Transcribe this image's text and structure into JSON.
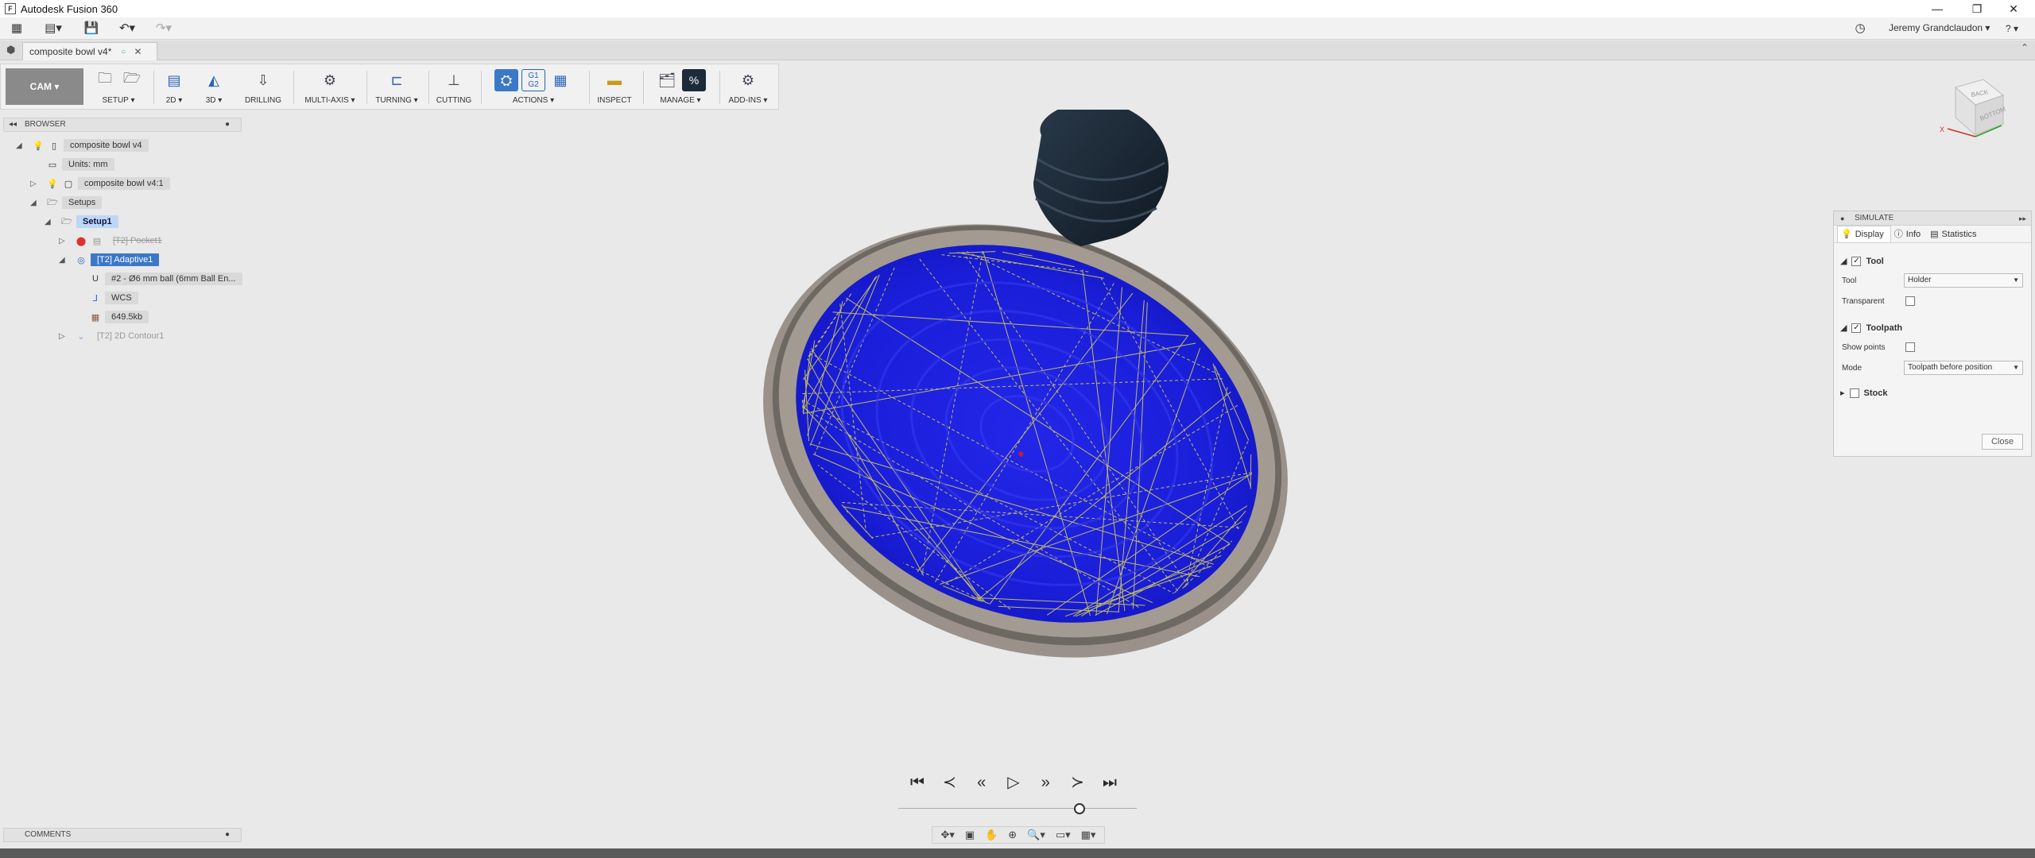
{
  "window": {
    "title": "Autodesk Fusion 360",
    "controls": [
      "—",
      "❐",
      "✕"
    ]
  },
  "qat": {
    "user_name": "Jeremy Grandclaudon ▾",
    "help": "? ▾"
  },
  "document_tab": {
    "name": "composite bowl v4*",
    "close": "✕"
  },
  "toolbar": {
    "workspace": "CAM ▾",
    "groups": [
      {
        "label": "SETUP ▾"
      },
      {
        "label": "2D ▾"
      },
      {
        "label": "3D ▾"
      },
      {
        "label": "DRILLING"
      },
      {
        "label": "MULTI-AXIS ▾"
      },
      {
        "label": "TURNING ▾"
      },
      {
        "label": "CUTTING"
      },
      {
        "label": "ACTIONS ▾"
      },
      {
        "label": "INSPECT"
      },
      {
        "label": "MANAGE ▾"
      },
      {
        "label": "ADD-INS ▾"
      }
    ],
    "g1g2": "G1\nG2",
    "percent": "%"
  },
  "browser": {
    "title": "BROWSER",
    "nodes": [
      {
        "label": "composite bowl v4"
      },
      {
        "label": "Units: mm"
      },
      {
        "label": "composite bowl v4:1"
      },
      {
        "label": "Setups"
      },
      {
        "label": "Setup1"
      },
      {
        "label": "[T2] Pocket1"
      },
      {
        "label": "[T2] Adaptive1"
      },
      {
        "label": "#2 - Ø6 mm ball (6mm Ball En..."
      },
      {
        "label": "WCS"
      },
      {
        "label": "649.5kb"
      },
      {
        "label": "[T2] 2D Contour1"
      }
    ]
  },
  "viewcube": {
    "top_face": "BACK",
    "side_face": "BOTTOM",
    "axis_x": "X"
  },
  "simulate": {
    "title": "SIMULATE",
    "tabs": [
      "Display",
      "Info",
      "Statistics"
    ],
    "tool_section": "Tool",
    "tool_label": "Tool",
    "tool_value": "Holder",
    "transparent_label": "Transparent",
    "toolpath_section": "Toolpath",
    "show_points_label": "Show points",
    "mode_label": "Mode",
    "mode_value": "Toolpath before position",
    "stock_section": "Stock",
    "close_label": "Close"
  },
  "comments": {
    "title": "COMMENTS"
  },
  "playback": {
    "position_fraction": 0.76
  },
  "colors": {
    "stock_blue": "#1a1ee0",
    "toolpath_yellow": "#e8e24a",
    "bowl_rim": "#8a827a",
    "holder": "#1c2936"
  }
}
